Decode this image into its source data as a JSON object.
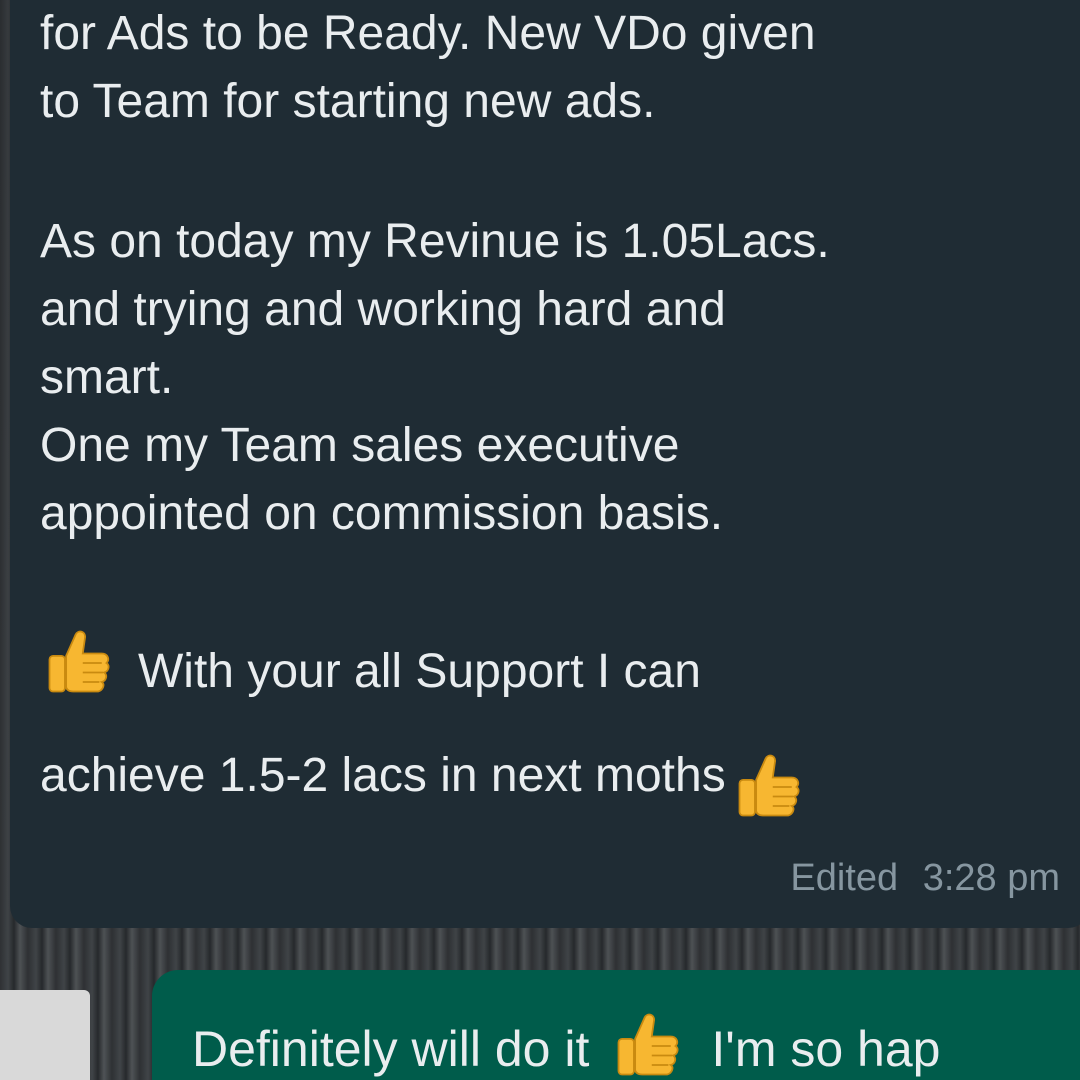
{
  "incoming_message": {
    "lines": [
      "for Ads to be Ready. New VDo given",
      "to Team for starting new ads.",
      "As on today my Revinue is 1.05Lacs.",
      "and trying and working hard and",
      "smart.",
      "One my Team sales executive",
      "appointed on commission basis.",
      "With your all Support I can",
      "achieve 1.5-2 lacs in next moths"
    ],
    "edited_label": "Edited",
    "time": "3:28 pm",
    "emoji": "thumbs-up-icon"
  },
  "outgoing_message": {
    "text_before_emoji": "Definitely will do it",
    "text_after_emoji": "I'm so hap",
    "emoji": "thumbs-up-icon"
  },
  "colors": {
    "incoming_bubble": "#1f2c34",
    "outgoing_bubble": "#005c4b",
    "message_text": "#e9edef",
    "meta_text": "#8696a0"
  }
}
